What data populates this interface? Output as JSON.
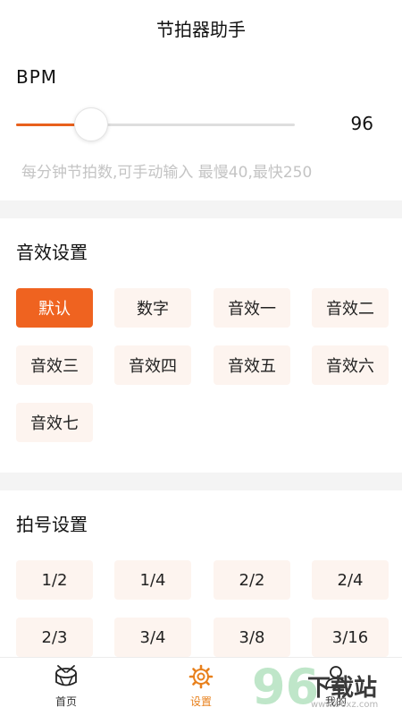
{
  "header": {
    "title": "节拍器助手"
  },
  "bpm": {
    "label": "BPM",
    "value": "96",
    "slider_fraction": 0.27,
    "hint": "每分钟节拍数,可手动输入  最慢40,最快250"
  },
  "sound": {
    "title": "音效设置",
    "options": [
      "默认",
      "数字",
      "音效一",
      "音效二",
      "音效三",
      "音效四",
      "音效五",
      "音效六",
      "音效七"
    ],
    "selected_index": 0
  },
  "meter": {
    "title": "拍号设置",
    "options": [
      "1/2",
      "1/4",
      "2/2",
      "2/4",
      "2/3",
      "3/4",
      "3/8",
      "3/16"
    ]
  },
  "nav": {
    "items": [
      {
        "label": "首页",
        "icon": "drum-icon"
      },
      {
        "label": "设置",
        "icon": "gear-icon"
      },
      {
        "label": "我的",
        "icon": "user-icon"
      }
    ],
    "active_index": 1
  },
  "watermark": {
    "number": "96",
    "text": "下载站",
    "url": "www.96xz.com"
  },
  "colors": {
    "accent": "#ef6320",
    "button_bg": "#fdf4ef",
    "nav_active": "#e8801c"
  }
}
